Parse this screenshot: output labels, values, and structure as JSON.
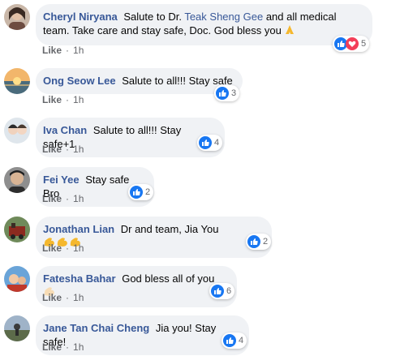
{
  "colors": {
    "link": "#385898",
    "bubble": "#f0f2f5",
    "meta": "#65676b",
    "like_blue": "#1877f2",
    "love_red": "#f33e58"
  },
  "comments": [
    {
      "author": "Cheryl Niryana",
      "text_before": "Salute to Dr.",
      "mention": "Teak Sheng Gee",
      "text_after": "and all medical team. Take care and stay safe, Doc. God bless you",
      "emoji": "folded-hands-emoji",
      "like": "Like",
      "time": "1h",
      "reactions": [
        "like",
        "love"
      ],
      "count": "5"
    },
    {
      "author": "Ong Seow Lee",
      "text": "Salute to all!!! Stay safe",
      "like": "Like",
      "time": "1h",
      "reactions": [
        "like"
      ],
      "count": "3"
    },
    {
      "author": "Iva Chan",
      "text": "Salute to all!!! Stay safe+1",
      "like": "Like",
      "time": "1h",
      "reactions": [
        "like"
      ],
      "count": "4"
    },
    {
      "author": "Fei Yee",
      "text": "Stay safe Bro",
      "like": "Like",
      "time": "1h",
      "reactions": [
        "like"
      ],
      "count": "2"
    },
    {
      "author": "Jonathan Lian",
      "text": "Dr and team, Jia You",
      "emoji": "flexed-biceps-emoji-x3",
      "like": "Like",
      "time": "1h",
      "reactions": [
        "like"
      ],
      "count": "2"
    },
    {
      "author": "Fatesha Bahar",
      "text": "God bless all of you",
      "emoji": "flexed-biceps-emoji",
      "like": "Like",
      "time": "1h",
      "reactions": [
        "like"
      ],
      "count": "6"
    },
    {
      "author": "Jane Tan Chai Cheng",
      "text": "Jia you! Stay safe!",
      "like": "Like",
      "time": "1h",
      "reactions": [
        "like"
      ],
      "count": "4"
    }
  ]
}
